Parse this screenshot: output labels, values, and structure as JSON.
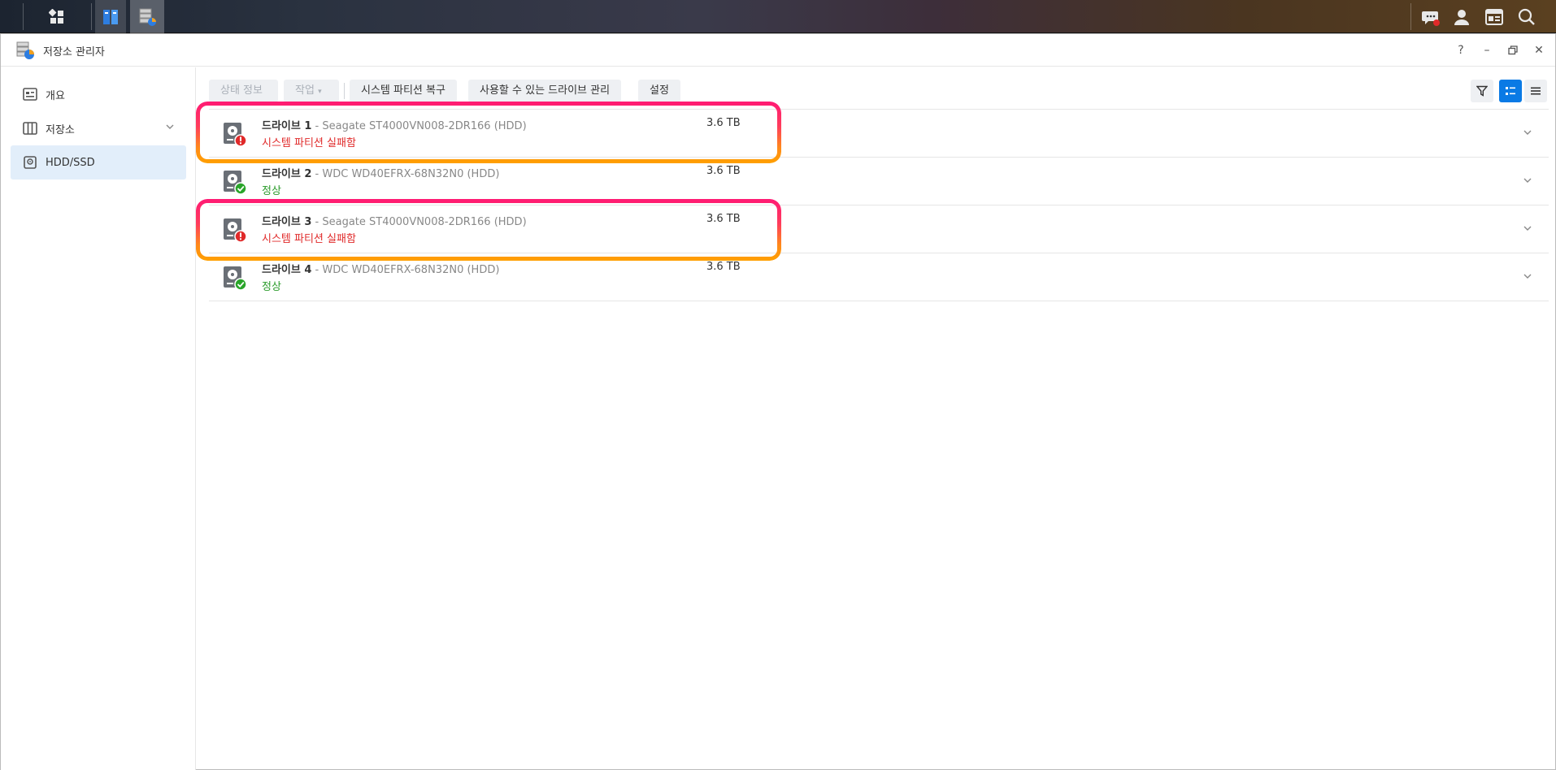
{
  "window": {
    "title": "저장소 관리자"
  },
  "window_controls": {
    "help": "?",
    "minimize": "–",
    "maximize": "▭",
    "close": "✕"
  },
  "sidebar": {
    "items": [
      {
        "label": "개요",
        "icon": "overview-icon"
      },
      {
        "label": "저장소",
        "icon": "storage-icon"
      },
      {
        "label": "HDD/SSD",
        "icon": "hdd-icon",
        "active": true
      }
    ]
  },
  "toolbar": {
    "status_info": "상태 정보",
    "action": "작업",
    "restore_partition": "시스템 파티션 복구",
    "manage_drives": "사용할 수 있는 드라이브 관리",
    "settings": "설정"
  },
  "drives": [
    {
      "name": "드라이브 1",
      "model": " - Seagate ST4000VN008-2DR166 (HDD)",
      "status": "시스템 파티션 실패함",
      "state": "error",
      "size": "3.6 TB"
    },
    {
      "name": "드라이브 2",
      "model": " - WDC WD40EFRX-68N32N0 (HDD)",
      "status": "정상",
      "state": "ok",
      "size": "3.6 TB"
    },
    {
      "name": "드라이브 3",
      "model": " - Seagate ST4000VN008-2DR166 (HDD)",
      "status": "시스템 파티션 실패함",
      "state": "error",
      "size": "3.6 TB"
    },
    {
      "name": "드라이브 4",
      "model": " - WDC WD40EFRX-68N32N0 (HDD)",
      "status": "정상",
      "state": "ok",
      "size": "3.6 TB"
    }
  ],
  "colors": {
    "accent": "#0a7ae5",
    "error": "#e02a2a",
    "ok": "#2a9b2a",
    "highlight_top": "#ff1a74",
    "highlight_bottom": "#ffa000"
  }
}
